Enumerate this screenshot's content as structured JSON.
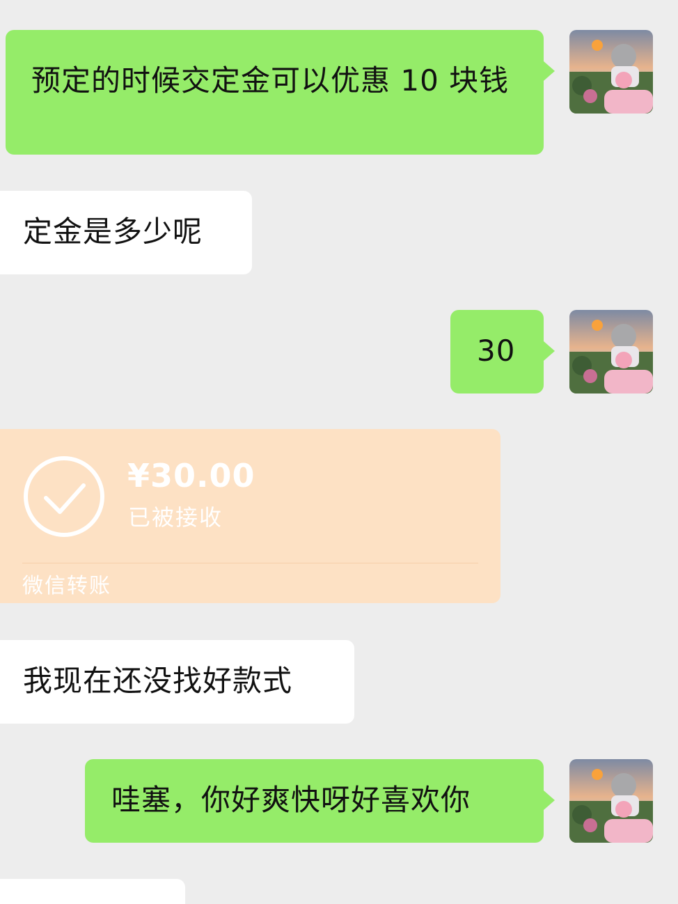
{
  "messages": [
    {
      "side": "sent",
      "text": "预定的时候交定金可以优惠 10 块钱"
    },
    {
      "side": "received",
      "text": "定金是多少呢"
    },
    {
      "side": "sent",
      "text": "30"
    },
    {
      "side": "received",
      "type": "transfer",
      "amount": "¥30.00",
      "status": "已被接收",
      "footer": "微信转账"
    },
    {
      "side": "received",
      "text": "我现在还没找好款式"
    },
    {
      "side": "sent",
      "text": "哇塞，你好爽快呀好喜欢你"
    }
  ],
  "colors": {
    "background": "#ededed",
    "sent_bubble": "#95ec69",
    "received_bubble": "#ffffff",
    "transfer_card": "#fde1c4"
  },
  "icons": [
    "user-avatar",
    "check-circle-icon"
  ]
}
